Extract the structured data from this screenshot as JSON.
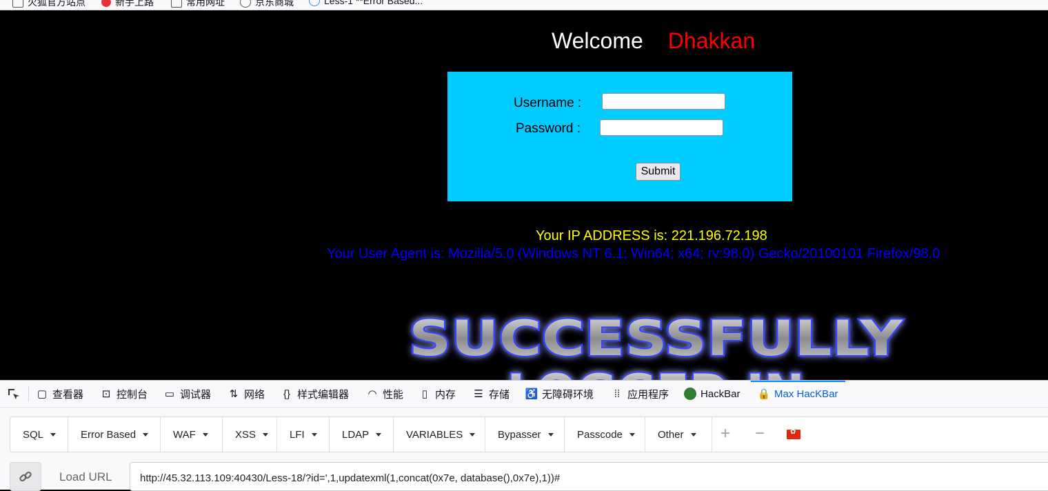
{
  "bookmarks": [
    {
      "label": "火狐官方站点",
      "icon": "firefox-icon"
    },
    {
      "label": "新手上路",
      "icon": "red-dot-icon"
    },
    {
      "label": "常用网址",
      "icon": "folder-icon"
    },
    {
      "label": "京东商城",
      "icon": "globe-icon"
    },
    {
      "label": "Less-1 **Error Based...",
      "icon": "page-icon"
    }
  ],
  "page": {
    "welcome": "Welcome",
    "name": "Dhakkan",
    "username_label": "Username :",
    "password_label": "Password :",
    "username_value": "",
    "password_value": "",
    "submit_label": "Submit",
    "ip_text": "Your IP ADDRESS is: 221.196.72.198",
    "ua_text": "Your User Agent is: Mozilla/5.0 (Windows NT 6.1; Win64; x64; rv:98.0) Gecko/20100101 Firefox/98.0",
    "success_line1": "SUCCESSFULLY",
    "success_line2": "LOGGED IN",
    "colors": {
      "background": "#000000",
      "box": "#00ccff",
      "name": "#ff0000",
      "ip": "#ffff00",
      "ua": "#0000ff"
    }
  },
  "devtools": {
    "tabs": [
      {
        "label": "查看器",
        "icon": "inspector-icon"
      },
      {
        "label": "控制台",
        "icon": "console-icon"
      },
      {
        "label": "调试器",
        "icon": "debugger-icon"
      },
      {
        "label": "网络",
        "icon": "network-icon"
      },
      {
        "label": "样式编辑器",
        "icon": "style-editor-icon"
      },
      {
        "label": "性能",
        "icon": "performance-icon"
      },
      {
        "label": "内存",
        "icon": "memory-icon"
      },
      {
        "label": "存储",
        "icon": "storage-icon"
      },
      {
        "label": "无障碍环境",
        "icon": "accessibility-icon"
      },
      {
        "label": "应用程序",
        "icon": "application-icon"
      },
      {
        "label": "HackBar",
        "icon": "hackbar-icon"
      },
      {
        "label": "Max HacKBar",
        "icon": "max-hackbar-icon",
        "active": true
      }
    ],
    "hackbar_menu": [
      "SQL",
      "Error Based",
      "WAF",
      "XSS",
      "LFI",
      "LDAP",
      "VARIABLES",
      "Bypasser",
      "Passcode",
      "Other"
    ],
    "load_url_label": "Load URL",
    "url_value": "http://45.32.113.109:40430/Less-18/?id=',1,updatexml(1,concat(0x7e, database(),0x7e),1))#"
  }
}
